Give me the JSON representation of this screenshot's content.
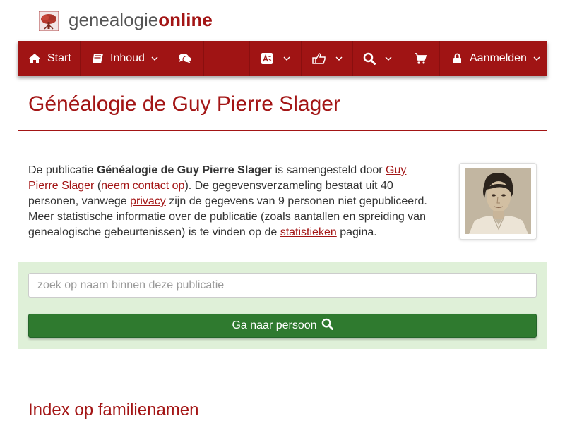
{
  "header": {
    "logo_part1": "genealogie",
    "logo_part2": "online",
    "logo_icon": "tree-icon"
  },
  "nav": {
    "items": [
      {
        "label": "Start",
        "icon": "home-icon"
      },
      {
        "label": "Inhoud",
        "icon": "book-icon"
      },
      {
        "label": "",
        "icon": "comments-icon"
      },
      {
        "label": "",
        "icon": "language-icon"
      },
      {
        "label": "",
        "icon": "thumbs-up-icon"
      },
      {
        "label": "",
        "icon": "search-icon"
      },
      {
        "label": "",
        "icon": "cart-icon"
      },
      {
        "label": "Aanmelden",
        "icon": "lock-icon"
      }
    ]
  },
  "page": {
    "title": "Généalogie de Guy Pierre Slager"
  },
  "intro": {
    "t1": "De publicatie ",
    "publication": "Généalogie de Guy Pierre Slager",
    "t2": " is samengesteld door ",
    "author_link": "Guy Pierre Slager",
    "t3": " (",
    "contact_link": "neem contact op",
    "t4": "). De gegevensverzameling bestaat uit 40 personen, vanwege ",
    "privacy_link": "privacy",
    "t5": " zijn de gegevens van 9 personen niet gepubliceerd. Meer statistische informatie over de publicatie (zoals aantallen en spreiding van genealogische gebeurtenissen) is te vinden op de ",
    "stats_link": "statistieken",
    "t6": " pagina."
  },
  "search": {
    "placeholder": "zoek op naam binnen deze publicatie",
    "value": "",
    "button_label": "Ga naar persoon"
  },
  "section": {
    "title": "Index op familienamen"
  },
  "colors": {
    "brand": "#a01414",
    "success_bg": "#dff0d8",
    "button": "#2f7a2f"
  }
}
